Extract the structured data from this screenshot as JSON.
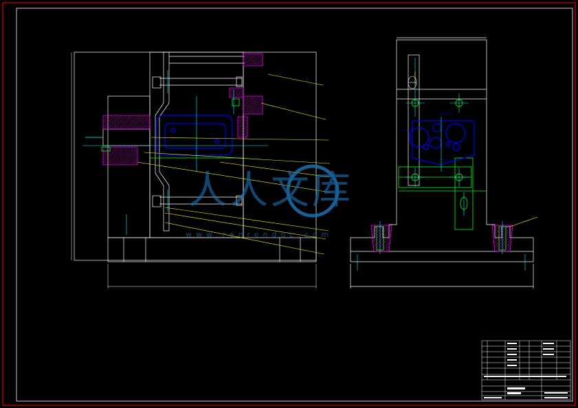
{
  "drawing": {
    "background": "#000000",
    "line_white": "#ffffff",
    "line_yellow": "#ffff00",
    "line_green": "#00ff00",
    "line_blue": "#0000ff",
    "line_magenta": "#ff00ff",
    "line_red": "#ff0000",
    "line_cyan": "#00ffff"
  },
  "watermark": {
    "text_cn": "人人文库",
    "url": "www.renrendoc.com",
    "color": "#1e6fb0"
  },
  "title_block": {
    "rows": [
      "",
      "",
      "",
      "",
      "",
      "",
      ""
    ],
    "title": ""
  }
}
